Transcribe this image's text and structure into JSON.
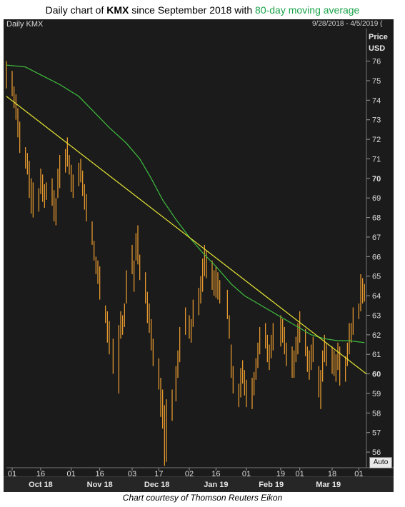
{
  "title": {
    "prefix": "Daily chart of ",
    "ticker": "KMX",
    "middle": " since September 2018 with ",
    "ma_text": "80-day moving average"
  },
  "header": {
    "left_label": "Daily KMX",
    "date_range": "9/28/2018 - 4/5/2019 (",
    "price_label": "Price",
    "currency_label": "USD",
    "auto_label": "Auto"
  },
  "caption": "Chart courtesy of Thomson Reuters Eikon",
  "colors": {
    "background": "#1b1b1b",
    "price_bars": "#f0a030",
    "moving_average": "#3fbf3f",
    "trendline": "#e6e635",
    "title_ma": "#1aa34a"
  },
  "chart_data": {
    "type": "line",
    "title": "Daily chart of KMX since September 2018 with 80-day moving average",
    "ylabel": "Price USD",
    "ylim": [
      55.2,
      77.3
    ],
    "y_ticks": [
      56,
      57,
      58,
      59,
      60,
      61,
      62,
      63,
      64,
      65,
      66,
      67,
      68,
      69,
      70,
      71,
      72,
      73,
      74,
      75,
      76
    ],
    "y_tick_labels": [
      "56",
      "57",
      "58",
      "59",
      "60",
      "61",
      "62",
      "63",
      "64",
      "65",
      "66",
      "67",
      "68",
      "69",
      "70",
      "71",
      "72",
      "73",
      "74",
      "75",
      "76"
    ],
    "x_day_ticks": [
      {
        "label": "01",
        "date": "2018-10-01"
      },
      {
        "label": "16",
        "date": "2018-10-16"
      },
      {
        "label": "01",
        "date": "2018-11-01"
      },
      {
        "label": "16",
        "date": "2018-11-16"
      },
      {
        "label": "03",
        "date": "2018-12-03"
      },
      {
        "label": "17",
        "date": "2018-12-17"
      },
      {
        "label": "02",
        "date": "2019-01-02"
      },
      {
        "label": "16",
        "date": "2019-01-16"
      },
      {
        "label": "01",
        "date": "2019-02-01"
      },
      {
        "label": "19",
        "date": "2019-02-19"
      },
      {
        "label": "01",
        "date": "2019-03-01"
      },
      {
        "label": "18",
        "date": "2019-03-18"
      },
      {
        "label": "01",
        "date": "2019-04-01"
      }
    ],
    "x_month_labels": [
      {
        "label": "Oct 18",
        "date": "2018-10-16"
      },
      {
        "label": "Nov 18",
        "date": "2018-11-16"
      },
      {
        "label": "Dec 18",
        "date": "2018-12-16"
      },
      {
        "label": "Jan 19",
        "date": "2019-01-16"
      },
      {
        "label": "Feb 19",
        "date": "2019-02-14"
      },
      {
        "label": "Mar 19",
        "date": "2019-03-16"
      }
    ],
    "x_range": [
      "2018-09-28",
      "2019-04-05"
    ],
    "series": [
      {
        "name": "KMX",
        "kind": "ohlc_bars",
        "bars": [
          [
            "2018-09-28",
            76.0,
            74.6
          ],
          [
            "2018-10-01",
            75.5,
            74.2
          ],
          [
            "2018-10-02",
            74.7,
            73.6
          ],
          [
            "2018-10-03",
            74.3,
            73.0
          ],
          [
            "2018-10-04",
            73.6,
            72.1
          ],
          [
            "2018-10-05",
            72.9,
            71.3
          ],
          [
            "2018-10-08",
            71.6,
            70.5
          ],
          [
            "2018-10-09",
            71.3,
            70.2
          ],
          [
            "2018-10-10",
            70.9,
            69.0
          ],
          [
            "2018-10-11",
            70.0,
            68.2
          ],
          [
            "2018-10-12",
            69.8,
            68.0
          ],
          [
            "2018-10-15",
            69.5,
            68.3
          ],
          [
            "2018-10-16",
            70.5,
            69.2
          ],
          [
            "2018-10-17",
            70.2,
            68.8
          ],
          [
            "2018-10-18",
            69.7,
            68.5
          ],
          [
            "2018-10-19",
            69.8,
            68.9
          ],
          [
            "2018-10-22",
            70.0,
            68.6
          ],
          [
            "2018-10-23",
            69.4,
            67.8
          ],
          [
            "2018-10-24",
            69.0,
            67.6
          ],
          [
            "2018-10-25",
            70.5,
            69.0
          ],
          [
            "2018-10-26",
            71.2,
            69.5
          ],
          [
            "2018-10-29",
            71.5,
            70.3
          ],
          [
            "2018-10-30",
            72.1,
            70.6
          ],
          [
            "2018-10-31",
            71.2,
            70.2
          ],
          [
            "2018-11-01",
            70.7,
            69.3
          ],
          [
            "2018-11-02",
            70.2,
            69.0
          ],
          [
            "2018-11-05",
            70.8,
            69.6
          ],
          [
            "2018-11-06",
            71.0,
            69.8
          ],
          [
            "2018-11-07",
            70.4,
            69.1
          ],
          [
            "2018-11-08",
            69.7,
            68.4
          ],
          [
            "2018-11-09",
            69.2,
            67.8
          ],
          [
            "2018-11-12",
            67.8,
            66.6
          ],
          [
            "2018-11-13",
            66.8,
            65.8
          ],
          [
            "2018-11-14",
            66.0,
            65.1
          ],
          [
            "2018-11-15",
            65.8,
            64.6
          ],
          [
            "2018-11-16",
            65.5,
            63.8
          ],
          [
            "2018-11-19",
            63.5,
            62.6
          ],
          [
            "2018-11-20",
            63.2,
            61.6
          ],
          [
            "2018-11-21",
            62.7,
            61.0
          ],
          [
            "2018-11-23",
            61.8,
            60.0
          ],
          [
            "2018-11-26",
            62.5,
            59.0
          ],
          [
            "2018-11-27",
            63.2,
            61.8
          ],
          [
            "2018-11-28",
            63.0,
            62.0
          ],
          [
            "2018-11-29",
            63.6,
            62.4
          ],
          [
            "2018-11-30",
            65.3,
            63.6
          ],
          [
            "2018-12-03",
            66.6,
            65.1
          ],
          [
            "2018-12-04",
            65.8,
            64.2
          ],
          [
            "2018-12-05",
            67.2,
            65.8
          ],
          [
            "2018-12-06",
            67.6,
            65.6
          ],
          [
            "2018-12-07",
            66.1,
            64.8
          ],
          [
            "2018-12-10",
            65.2,
            63.6
          ],
          [
            "2018-12-11",
            64.2,
            62.6
          ],
          [
            "2018-12-12",
            63.6,
            62.1
          ],
          [
            "2018-12-13",
            62.8,
            61.2
          ],
          [
            "2018-12-14",
            61.8,
            60.4
          ],
          [
            "2018-12-17",
            60.8,
            59.2
          ],
          [
            "2018-12-18",
            59.8,
            57.8
          ],
          [
            "2018-12-19",
            59.2,
            57.2
          ],
          [
            "2018-12-20",
            58.4,
            55.3
          ],
          [
            "2018-12-21",
            58.7,
            55.5
          ],
          [
            "2018-12-24",
            59.2,
            57.6
          ],
          [
            "2018-12-26",
            60.4,
            58.6
          ],
          [
            "2018-12-27",
            61.2,
            59.8
          ],
          [
            "2018-12-28",
            62.4,
            60.6
          ],
          [
            "2018-12-31",
            63.4,
            62.0
          ],
          [
            "2019-01-02",
            63.0,
            61.8
          ],
          [
            "2019-01-03",
            62.8,
            61.6
          ],
          [
            "2019-01-04",
            63.8,
            62.4
          ],
          [
            "2019-01-07",
            64.4,
            63.0
          ],
          [
            "2019-01-08",
            65.0,
            63.6
          ],
          [
            "2019-01-09",
            65.9,
            64.2
          ],
          [
            "2019-01-10",
            66.6,
            65.0
          ],
          [
            "2019-01-11",
            66.3,
            64.9
          ],
          [
            "2019-01-14",
            65.8,
            64.3
          ],
          [
            "2019-01-15",
            65.3,
            64.0
          ],
          [
            "2019-01-16",
            65.5,
            63.9
          ],
          [
            "2019-01-17",
            65.2,
            63.8
          ],
          [
            "2019-01-18",
            64.8,
            63.6
          ],
          [
            "2019-01-22",
            64.3,
            62.8
          ],
          [
            "2019-01-23",
            63.0,
            61.8
          ],
          [
            "2019-01-24",
            61.5,
            59.8
          ],
          [
            "2019-01-25",
            60.4,
            59.0
          ],
          [
            "2019-01-28",
            59.5,
            58.3
          ],
          [
            "2019-01-29",
            60.3,
            58.8
          ],
          [
            "2019-01-30",
            60.7,
            59.5
          ],
          [
            "2019-01-31",
            60.2,
            58.9
          ],
          [
            "2019-02-01",
            59.7,
            58.3
          ],
          [
            "2019-02-04",
            59.8,
            58.2
          ],
          [
            "2019-02-05",
            60.1,
            58.9
          ],
          [
            "2019-02-06",
            60.8,
            59.7
          ],
          [
            "2019-02-07",
            61.6,
            60.3
          ],
          [
            "2019-02-08",
            62.4,
            61.0
          ],
          [
            "2019-02-11",
            62.6,
            61.3
          ],
          [
            "2019-02-12",
            62.0,
            60.6
          ],
          [
            "2019-02-13",
            61.5,
            60.2
          ],
          [
            "2019-02-14",
            62.0,
            60.8
          ],
          [
            "2019-02-15",
            62.6,
            61.2
          ],
          [
            "2019-02-19",
            63.0,
            61.4
          ],
          [
            "2019-02-20",
            62.8,
            61.6
          ],
          [
            "2019-02-21",
            62.4,
            61.0
          ],
          [
            "2019-02-22",
            61.6,
            60.4
          ],
          [
            "2019-02-25",
            61.4,
            59.8
          ],
          [
            "2019-02-26",
            61.2,
            59.8
          ],
          [
            "2019-02-27",
            61.9,
            60.6
          ],
          [
            "2019-02-28",
            62.6,
            61.0
          ],
          [
            "2019-03-01",
            63.2,
            61.6
          ],
          [
            "2019-03-04",
            62.3,
            60.9
          ],
          [
            "2019-03-05",
            61.4,
            60.1
          ],
          [
            "2019-03-06",
            61.2,
            59.7
          ],
          [
            "2019-03-07",
            61.5,
            60.2
          ],
          [
            "2019-03-08",
            61.9,
            60.6
          ],
          [
            "2019-03-11",
            60.4,
            58.8
          ],
          [
            "2019-03-12",
            60.2,
            58.2
          ],
          [
            "2019-03-13",
            61.2,
            59.6
          ],
          [
            "2019-03-14",
            62.0,
            60.6
          ],
          [
            "2019-03-15",
            61.6,
            60.4
          ],
          [
            "2019-03-18",
            61.4,
            60.0
          ],
          [
            "2019-03-19",
            61.2,
            59.9
          ],
          [
            "2019-03-20",
            61.0,
            59.6
          ],
          [
            "2019-03-21",
            61.6,
            60.2
          ],
          [
            "2019-03-22",
            61.4,
            59.4
          ],
          [
            "2019-03-25",
            60.9,
            59.6
          ],
          [
            "2019-03-26",
            61.6,
            60.4
          ],
          [
            "2019-03-27",
            62.6,
            61.0
          ],
          [
            "2019-03-28",
            62.6,
            61.6
          ],
          [
            "2019-03-29",
            63.4,
            62.0
          ],
          [
            "2019-04-01",
            63.6,
            62.8
          ],
          [
            "2019-04-02",
            65.1,
            63.2
          ],
          [
            "2019-04-03",
            64.9,
            63.6
          ],
          [
            "2019-04-04",
            64.6,
            63.7
          ]
        ]
      },
      {
        "name": "80-day moving average",
        "kind": "line",
        "points": [
          [
            "2018-09-28",
            75.8
          ],
          [
            "2018-10-08",
            75.7
          ],
          [
            "2018-10-16",
            75.3
          ],
          [
            "2018-10-26",
            74.8
          ],
          [
            "2018-11-05",
            74.2
          ],
          [
            "2018-11-13",
            73.4
          ],
          [
            "2018-11-21",
            72.6
          ],
          [
            "2018-11-30",
            71.8
          ],
          [
            "2018-12-07",
            71.0
          ],
          [
            "2018-12-13",
            70.0
          ],
          [
            "2018-12-19",
            68.9
          ],
          [
            "2018-12-26",
            67.9
          ],
          [
            "2019-01-02",
            67.0
          ],
          [
            "2019-01-09",
            66.2
          ],
          [
            "2019-01-16",
            65.5
          ],
          [
            "2019-01-24",
            64.6
          ],
          [
            "2019-01-31",
            64.0
          ],
          [
            "2019-02-07",
            63.6
          ],
          [
            "2019-02-14",
            63.2
          ],
          [
            "2019-02-21",
            62.8
          ],
          [
            "2019-02-28",
            62.4
          ],
          [
            "2019-03-07",
            62.0
          ],
          [
            "2019-03-14",
            61.8
          ],
          [
            "2019-03-21",
            61.7
          ],
          [
            "2019-03-27",
            61.7
          ],
          [
            "2019-04-04",
            61.6
          ]
        ]
      },
      {
        "name": "trendline",
        "kind": "line",
        "points": [
          [
            "2018-09-28",
            74.2
          ],
          [
            "2019-04-05",
            60.0
          ]
        ]
      }
    ]
  }
}
